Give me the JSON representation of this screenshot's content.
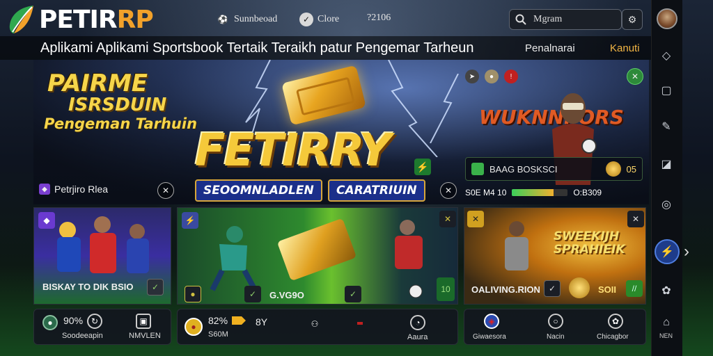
{
  "brand": {
    "name_a": "PETIR",
    "name_b": "RP"
  },
  "header": {
    "item1": "Sunnbeoad",
    "item2": "Clore",
    "item3": "?2106",
    "search_value": "Mgram"
  },
  "tagline": {
    "text": "Aplikami Aplikami Sportsbook Tertaik Teraikh patur Pengemar Tarheun",
    "link1": "Penalnarai",
    "link2": "Kanuti"
  },
  "hero": {
    "promo_line1": "PAIRME",
    "promo_line2": "ISRSDUIN",
    "promo_line3": "Pengeman Tarhuin",
    "brand_big": "FETIRRY",
    "chip_a": "SEOOMNLADLEN",
    "chip_b": "CARATRIUIN",
    "tag_label": "Petrjiro Rlea",
    "mascot_title": "WUKNNI ORS",
    "odds_label": "BAAG BOSKSCI",
    "odds_value": "05",
    "bar_left": "S0E M4 10",
    "bar_right": "O:B309",
    "bar_fill": 0.75
  },
  "cards": [
    {
      "label": "BISKAY TO DIK BSIO"
    },
    {
      "label": "G.VG9O"
    },
    {
      "label": "10"
    },
    {
      "title": "SWEEKIJH SPRAHIEIK",
      "label": "OALIVING.RION",
      "value": "SOII"
    }
  ],
  "stats": [
    {
      "value": "90%",
      "label": "Soodeeapin"
    },
    {
      "label": "NMVLEN"
    },
    {
      "value": "82%",
      "sub": "S60M"
    },
    {
      "value": "8Y"
    },
    {
      "label": "Aaura"
    },
    {
      "label": "Giwaesora"
    },
    {
      "label": "Nacin"
    },
    {
      "label": "Chicagbor"
    }
  ],
  "rail": {
    "bottom_label": "NEN"
  },
  "colors": {
    "accent": "#f2a12a",
    "gold": "#f5c93a",
    "rail_active": "#1e3c8a"
  },
  "icons": [
    "logo-leaf-icon",
    "soccer-icon",
    "check-icon",
    "search-icon",
    "filter-icon",
    "chat-icon",
    "message-icon",
    "edit-icon",
    "pencil-icon",
    "basketball-icon",
    "sport-icon",
    "chevron-right-icon",
    "settings-icon",
    "home-icon"
  ]
}
